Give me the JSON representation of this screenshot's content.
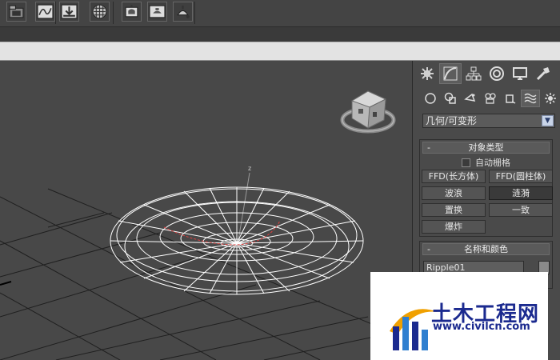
{
  "toolbar": {
    "buttons": [
      "scene-explorer-icon",
      "curve-editor-icon",
      "dope-sheet-icon",
      "material-editor-icon",
      "render-setup-icon",
      "rendered-frame-icon",
      "render-icon"
    ]
  },
  "command_panel": {
    "tabs": [
      "create-icon",
      "modify-icon",
      "hierarchy-icon",
      "motion-icon",
      "display-icon",
      "utilities-icon"
    ],
    "subtabs": [
      "geometry-icon",
      "shapes-icon",
      "lights-icon",
      "cameras-icon",
      "helpers-icon",
      "space-warps-icon",
      "systems-icon"
    ],
    "category": "几何/可变形",
    "object_type": {
      "header": "对象类型",
      "autogrid_label": "自动栅格",
      "buttons": [
        "FFD(长方体)",
        "FFD(圆柱体)",
        "波浪",
        "涟漪",
        "置换",
        "一致",
        "爆炸"
      ],
      "pressed": "涟漪"
    },
    "name_color": {
      "header": "名称和颜色",
      "name_value": "Ripple01",
      "color": "#8a8a8a"
    }
  },
  "viewport": {
    "axis_label": "z",
    "background": "#484848",
    "grid_color": "#222222",
    "mesh_color": "#ffffff",
    "gizmo_color": "#e04040"
  },
  "watermark": {
    "title": "土木工程网",
    "url": "www.civilcn.com"
  },
  "colors": {
    "ribbon": "#e3e3e3",
    "panel": "#4a4a4a",
    "brand_blue": "#1b2a8f"
  }
}
